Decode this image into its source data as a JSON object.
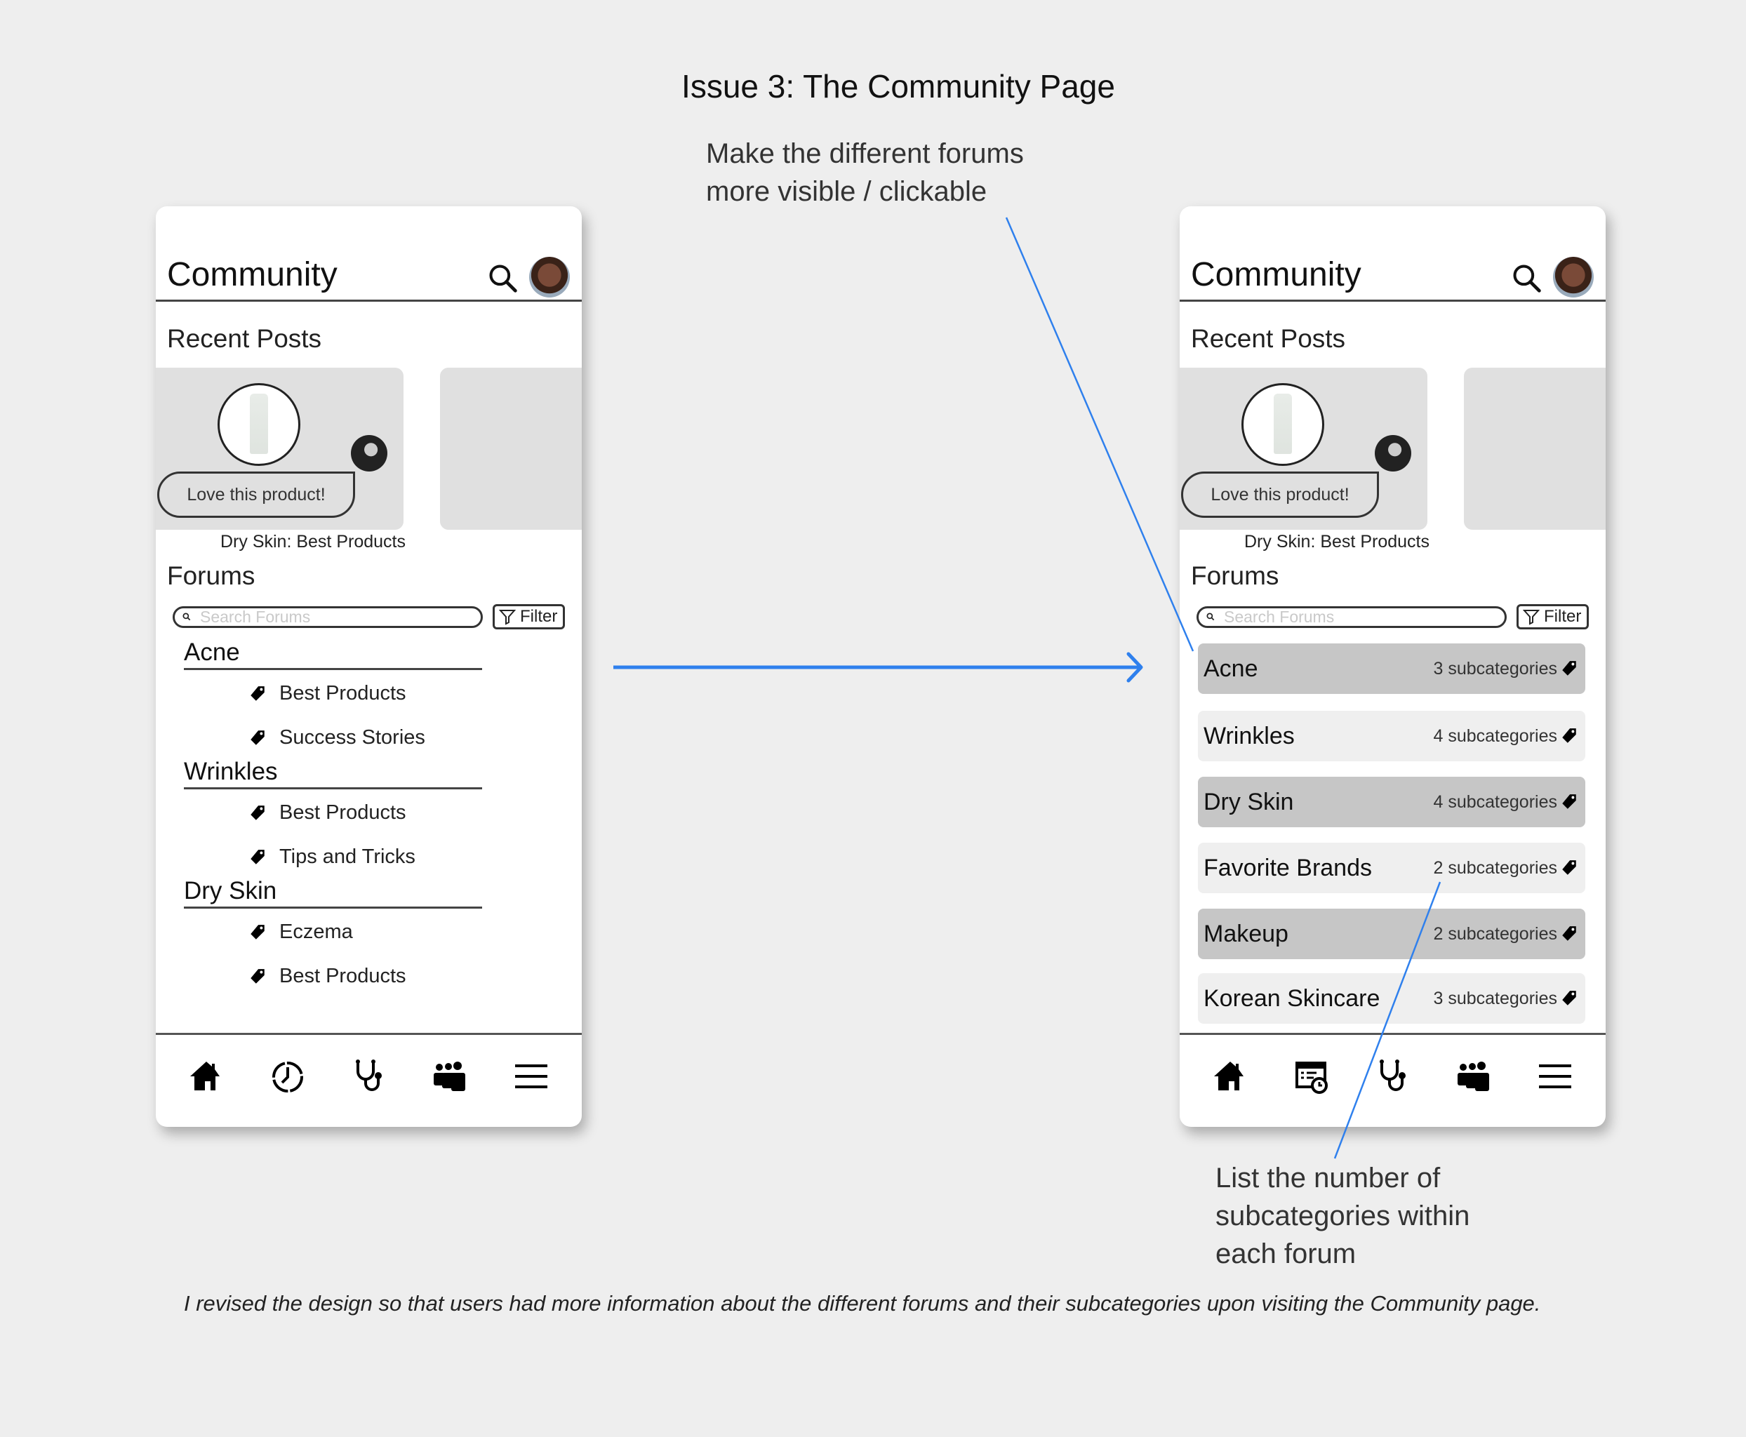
{
  "title": "Issue 3: The Community Page",
  "annotations": {
    "top_note": [
      "Make the different forums",
      "more visible / clickable"
    ],
    "bottom_note": [
      "List the number of",
      "subcategories within",
      "each forum"
    ],
    "caption": "I revised the design so that users had more information about the different forums and their subcategories upon visiting the Community page.",
    "arrow_color": "#2f80ed"
  },
  "before": {
    "header_title": "Community",
    "recent_posts_label": "Recent Posts",
    "post": {
      "comment": "Love this product!",
      "caption": "Dry Skin: Best Products"
    },
    "forums_label": "Forums",
    "search_placeholder": "Search Forums",
    "filter_label": "Filter",
    "forums": [
      {
        "name": "Acne",
        "subcategories": [
          "Best Products",
          "Success Stories"
        ]
      },
      {
        "name": "Wrinkles",
        "subcategories": [
          "Best Products",
          "Tips and Tricks"
        ]
      },
      {
        "name": "Dry Skin",
        "subcategories": [
          "Eczema",
          "Best Products"
        ]
      }
    ],
    "nav": [
      "home-icon",
      "clock-icon",
      "stethoscope-icon",
      "community-icon",
      "menu-icon"
    ]
  },
  "after": {
    "header_title": "Community",
    "recent_posts_label": "Recent Posts",
    "post": {
      "comment": "Love this product!",
      "caption": "Dry Skin: Best Products"
    },
    "forums_label": "Forums",
    "search_placeholder": "Search Forums",
    "filter_label": "Filter",
    "forums": [
      {
        "name": "Acne",
        "count": "3 subcategories",
        "shade": "dark"
      },
      {
        "name": "Wrinkles",
        "count": "4 subcategories",
        "shade": "light"
      },
      {
        "name": "Dry Skin",
        "count": "4 subcategories",
        "shade": "dark"
      },
      {
        "name": "Favorite Brands",
        "count": "2 subcategories",
        "shade": "light"
      },
      {
        "name": "Makeup",
        "count": "2 subcategories",
        "shade": "dark"
      },
      {
        "name": "Korean Skincare",
        "count": "3 subcategories",
        "shade": "light"
      }
    ],
    "nav": [
      "home-icon",
      "schedule-icon",
      "stethoscope-icon",
      "community-icon",
      "menu-icon"
    ]
  }
}
